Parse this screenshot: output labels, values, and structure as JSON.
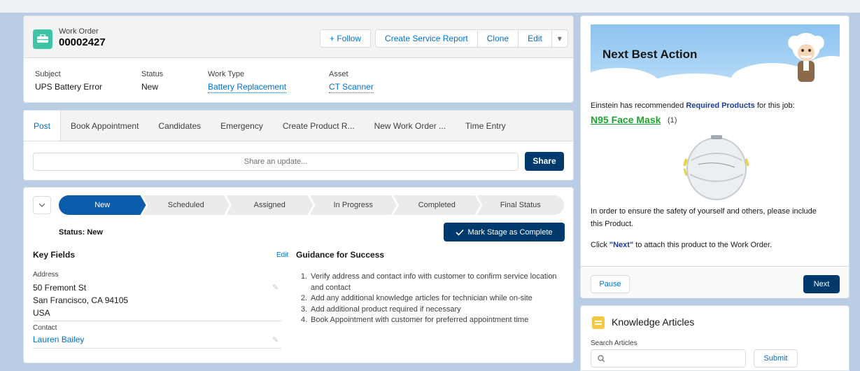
{
  "header": {
    "object_label": "Work Order",
    "number": "00002427",
    "buttons": {
      "follow": "+ Follow",
      "service_report": "Create Service Report",
      "clone": "Clone",
      "edit": "Edit",
      "more": "▾"
    },
    "fields": [
      {
        "label": "Subject",
        "value": "UPS Battery Error"
      },
      {
        "label": "Status",
        "value": "New"
      },
      {
        "label": "Work Type",
        "value": "Battery Replacement"
      },
      {
        "label": "Asset",
        "value": "CT Scanner"
      }
    ],
    "colors": {
      "icon": "#3ec5a5",
      "link": "#0070d2",
      "brand_dark": "#00396b"
    }
  },
  "feed": {
    "tabs": [
      "Post",
      "Book Appointment",
      "Candidates",
      "Emergency",
      "Create Product R...",
      "New Work Order ...",
      "Time Entry"
    ],
    "share_placeholder": "Share an update...",
    "share_button": "Share"
  },
  "path": {
    "stages": [
      "New",
      "Scheduled",
      "Assigned",
      "In Progress",
      "Completed",
      "Final Status"
    ],
    "active_stage": "New",
    "status_text": "Status: New",
    "mark_button": "Mark Stage as Complete",
    "key_fields_title": "Key Fields",
    "edit_label": "Edit",
    "address_label": "Address",
    "address_lines": [
      "50 Fremont St",
      "San Francisco, CA 94105",
      "USA"
    ],
    "contact_label": "Contact",
    "contact_value": "Lauren Bailey",
    "guidance_title": "Guidance for Success",
    "guidance": [
      {
        "num": "1.",
        "text": "Verify address and contact info with customer to confirm service location and contact"
      },
      {
        "num": "2.",
        "text": "Add any additional knowledge articles for technician while on-site"
      },
      {
        "num": "3.",
        "text": "Add additional product required if necessary"
      },
      {
        "num": "4.",
        "text": "Book Appointment with customer for preferred appointment time"
      }
    ]
  },
  "nba": {
    "title": "Next Best Action",
    "intro_prefix": "Einstein has recommended ",
    "intro_highlight": "Required Products",
    "intro_suffix": " for this job:",
    "product": "N95 Face Mask",
    "quantity": "(1)",
    "body": "In order to ensure the safety of yourself and others, please include this Product.",
    "next_prefix": "Click ",
    "next_highlight": "\"Next\"",
    "next_suffix": " to attach this product to the Work Order.",
    "pause_button": "Pause",
    "next_button": "Next",
    "product_color": "#1fa52f"
  },
  "knowledge": {
    "title": "Knowledge Articles",
    "search_label": "Search Articles",
    "submit_button": "Submit"
  }
}
